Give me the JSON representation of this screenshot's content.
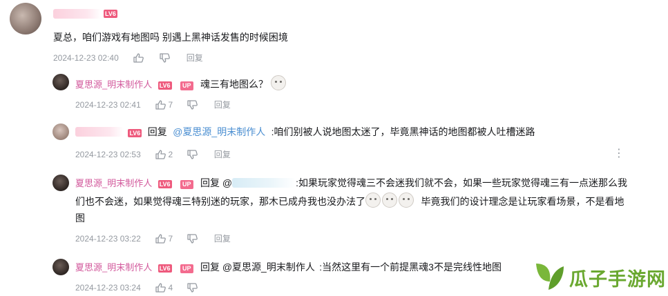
{
  "top_comment": {
    "level": "LV6",
    "text": "夏总，咱们游戏有地图吗 别遇上黑神话发售的时候困境",
    "time": "2024-12-23 02:40",
    "reply": "回复"
  },
  "replies": [
    {
      "user": "夏思源_明末制作人",
      "level": "LV6",
      "up": "UP",
      "prefix": "",
      "mention": "",
      "text": "魂三有地图么？",
      "time": "2024-12-23 02:41",
      "likes": "7",
      "reply": "回复"
    },
    {
      "user": "",
      "level": "LV6",
      "prefix": "回复",
      "mention": "@夏思源_明末制作人",
      "text": ":咱们别被人说地图太迷了，毕竟黑神话的地图都被人吐槽迷路",
      "time": "2024-12-23 02:53",
      "likes": "2",
      "reply": "回复",
      "more": "⋮"
    },
    {
      "user": "夏思源_明末制作人",
      "level": "LV6",
      "up": "UP",
      "prefix": "回复 @",
      "text_line1": ":如果玩家觉得魂三不会迷我们就不会，如果一些玩家觉得魂三有一点迷那么我",
      "text_line2a": "们也不会迷，如果觉得魂三特别迷的玩家，那木已成舟我也没办法了",
      "text_line2b": "毕竟我们的设计理念是让玩家看场景，不是看地",
      "text_line3": "图",
      "time": "2024-12-23 03:22",
      "likes": "7",
      "reply": "回复"
    },
    {
      "user": "夏思源_明末制作人",
      "level": "LV6",
      "up": "UP",
      "prefix": "回复 @夏思源_明末制作人",
      "text": ":当然这里有一个前提黑魂3不是完线性地图",
      "time": "2024-12-23 03:24",
      "likes": "4",
      "reply": "回复"
    }
  ],
  "watermark": {
    "text": "瓜子手游网",
    "color": "#6aa830"
  },
  "colors": {
    "username": "#d2589b",
    "mention": "#4a8ed1",
    "meta": "#9499a0",
    "level_badge": "#ee5a7d"
  }
}
